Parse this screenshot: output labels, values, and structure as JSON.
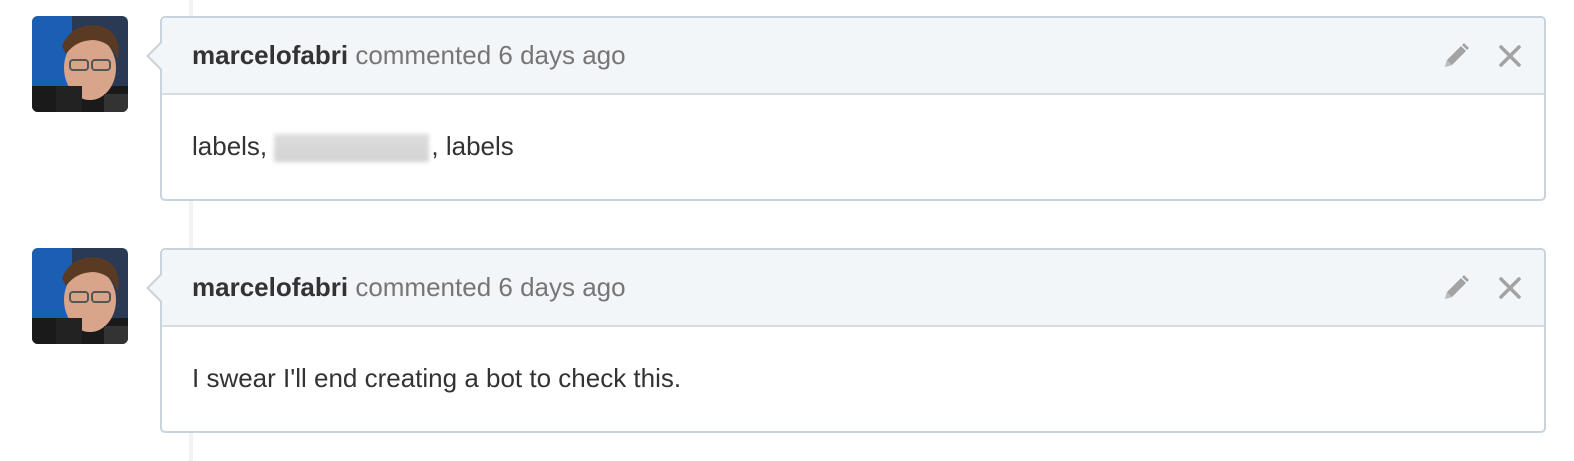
{
  "comments": [
    {
      "author": "marcelofabri",
      "action": "commented",
      "time": "6 days ago",
      "body_before": "labels,",
      "body_after": ", labels",
      "has_redaction": true,
      "icons": {
        "edit": "pencil-icon",
        "delete": "close-icon"
      }
    },
    {
      "author": "marcelofabri",
      "action": "commented",
      "time": "6 days ago",
      "body": "I swear I'll end creating a bot to check this.",
      "icons": {
        "edit": "pencil-icon",
        "delete": "close-icon"
      }
    }
  ],
  "colors": {
    "header_bg": "#f2f6f9",
    "border": "#c9d3db",
    "meta_text": "#767676",
    "icon": "#a3a3a3"
  }
}
